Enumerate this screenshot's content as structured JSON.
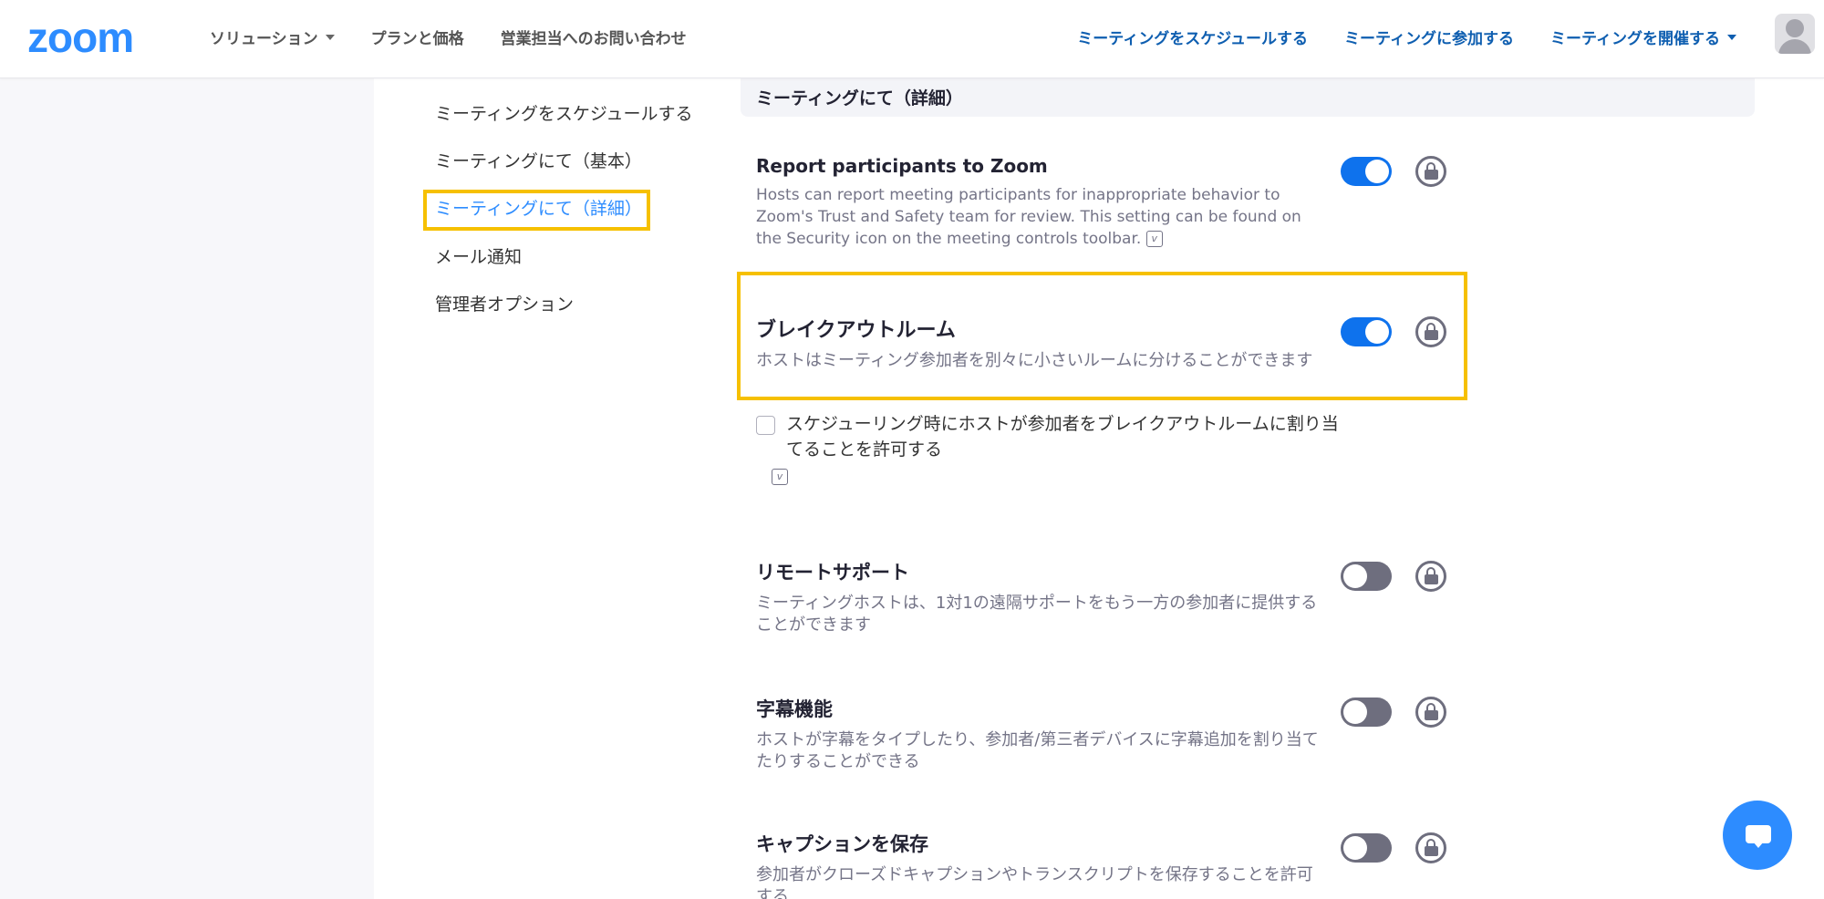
{
  "header": {
    "logo": "zoom",
    "nav_left": [
      "ソリューション",
      "プランと価格",
      "営業担当へのお問い合わせ"
    ],
    "nav_right": [
      "ミーティングをスケジュールする",
      "ミーティングに参加する",
      "ミーティングを開催する"
    ]
  },
  "sidebar": {
    "items": [
      {
        "label": "ミーティングをスケジュールする"
      },
      {
        "label": "ミーティングにて（基本）"
      },
      {
        "label": "ミーティングにて（詳細）"
      },
      {
        "label": "メール通知"
      },
      {
        "label": "管理者オプション"
      }
    ]
  },
  "section": {
    "title": "ミーティングにて（詳細）"
  },
  "settings": [
    {
      "title": "Report participants to Zoom",
      "desc": "Hosts can report meeting participants for inappropriate behavior to Zoom's Trust and Safety team for review. This setting can be found on the Security icon on the meeting controls toolbar.",
      "enabled": true
    },
    {
      "title": "ブレイクアウトルーム",
      "desc": "ホストはミーティング参加者を別々に小さいルームに分けることができます",
      "enabled": true
    },
    {
      "title": "リモートサポート",
      "desc": "ミーティングホストは、1対1の遠隔サポートをもう一方の参加者に提供することができます",
      "enabled": false
    },
    {
      "title": "字幕機能",
      "desc": "ホストが字幕をタイプしたり、参加者/第三者デバイスに字幕追加を割り当てたりすることができる",
      "enabled": false
    },
    {
      "title": "キャプションを保存",
      "desc": "参加者がクローズドキャプションやトランスクリプトを保存することを許可する",
      "enabled": false
    }
  ],
  "breakout_option": {
    "label": "スケジューリング時にホストが参加者をブレイクアウトルームに割り当てることを許可する",
    "checked": false
  },
  "colors": {
    "brand": "#2d8cff",
    "toggle_on": "#0e72ed",
    "toggle_off": "#6e6e7e",
    "highlight": "#f6c000"
  }
}
